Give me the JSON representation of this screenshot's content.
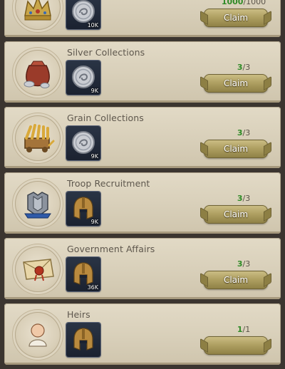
{
  "tasks": [
    {
      "title": "",
      "icon": "crown-icon",
      "reward": {
        "icon": "silver-coin-icon",
        "count": "10K"
      },
      "progress": {
        "current": "1000",
        "separator": "/",
        "total": "1000"
      },
      "button": "Claim"
    },
    {
      "title": "Silver Collections",
      "icon": "silver-sack-icon",
      "reward": {
        "icon": "silver-coin-icon",
        "count": "9K"
      },
      "progress": {
        "current": "3",
        "separator": "/",
        "total": "3"
      },
      "button": "Claim"
    },
    {
      "title": "Grain Collections",
      "icon": "grain-cart-icon",
      "reward": {
        "icon": "silver-coin-icon",
        "count": "9K"
      },
      "progress": {
        "current": "3",
        "separator": "/",
        "total": "3"
      },
      "button": "Claim"
    },
    {
      "title": "Troop Recruitment",
      "icon": "armor-icon",
      "reward": {
        "icon": "spartan-helmet-icon",
        "count": "9K"
      },
      "progress": {
        "current": "3",
        "separator": "/",
        "total": "3"
      },
      "button": "Claim"
    },
    {
      "title": "Government Affairs",
      "icon": "sealed-letter-icon",
      "reward": {
        "icon": "spartan-helmet-icon",
        "count": "36K"
      },
      "progress": {
        "current": "3",
        "separator": "/",
        "total": "3"
      },
      "button": "Claim"
    },
    {
      "title": "Heirs",
      "icon": "baby-icon",
      "reward": {
        "icon": "spartan-helmet-icon",
        "count": ""
      },
      "progress": {
        "current": "1",
        "separator": "/",
        "total": "1"
      },
      "button": ""
    }
  ],
  "colors": {
    "progress_complete": "#2f8a26",
    "card_bg": "#d8cfb9",
    "button_gold": "#b0a163"
  }
}
